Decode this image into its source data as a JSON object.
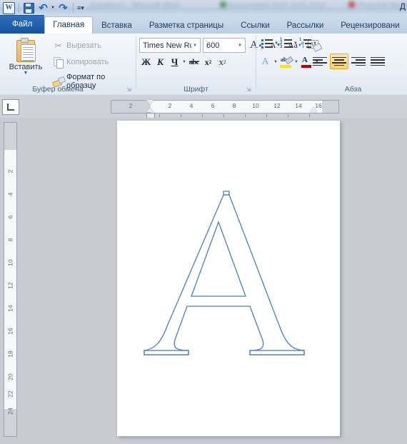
{
  "window": {
    "app_icon": "word-icon",
    "quick_access": [
      {
        "name": "save-icon",
        "label": "Сохранить"
      },
      {
        "name": "undo-icon",
        "label": "Отменить"
      },
      {
        "name": "redo-icon",
        "label": "Вернуть"
      },
      {
        "name": "customize-qat-icon",
        "label": "Настройка панели быстрого доступа"
      }
    ],
    "title_tail": "Д"
  },
  "tabs": [
    {
      "id": "file",
      "label": "Файл"
    },
    {
      "id": "home",
      "label": "Главная"
    },
    {
      "id": "insert",
      "label": "Вставка"
    },
    {
      "id": "layout",
      "label": "Разметка страницы"
    },
    {
      "id": "references",
      "label": "Ссылки"
    },
    {
      "id": "mailings",
      "label": "Рассылки"
    },
    {
      "id": "review",
      "label": "Рецензировани"
    }
  ],
  "ribbon": {
    "clipboard": {
      "group_label": "Буфер обмена",
      "paste_label": "Вставить",
      "cut_label": "Вырезать",
      "copy_label": "Копировать",
      "format_painter_label": "Формат по образцу"
    },
    "font": {
      "group_label": "Шрифт",
      "font_name": "Times New Rc",
      "font_size": "600",
      "grow_font_label": "A",
      "shrink_font_label": "A",
      "change_case_label": "Aa",
      "clear_format_label": "Aa",
      "bold_label": "Ж",
      "italic_label": "К",
      "underline_label": "Ч",
      "strike_label": "abc",
      "subscript_label": "x",
      "subscript_index": "2",
      "superscript_label": "x",
      "superscript_index": "2",
      "text_effects_label": "A",
      "highlight_label": "ab",
      "font_color_label": "A",
      "highlight_color": "#ffe400",
      "font_color": "#c00000"
    },
    "paragraph": {
      "group_label": "Абза",
      "bullets_label": "Маркеры",
      "numbering_label": "Нумерация",
      "multilevel_label": "Многоуровневый список",
      "align_left_label": "По левому краю",
      "align_center_label": "По центру",
      "align_right_label": "По правому краю",
      "align_justify_label": "По ширине",
      "active_alignment": "center",
      "active_color": "#ffd169"
    }
  },
  "rulers": {
    "tab_stop_selector": "left-tab-icon",
    "horizontal": [
      "2",
      "2",
      "4",
      "6",
      "8",
      "10",
      "12",
      "14",
      "16"
    ],
    "vertical": [
      "2",
      "4",
      "6",
      "8",
      "10",
      "12",
      "14",
      "16",
      "18",
      "20",
      "22",
      "24"
    ]
  },
  "document": {
    "page_color": "#ffffff",
    "background_color": "#c8ccd2",
    "content_glyph": "A",
    "glyph_outline_color": "#4a7ebb",
    "glyph_fill": "none"
  }
}
